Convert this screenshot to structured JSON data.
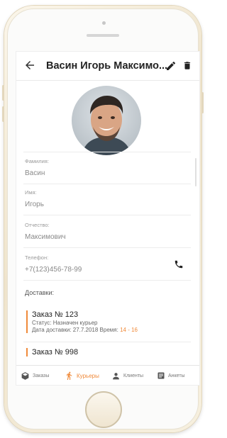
{
  "header": {
    "title": "Васин Игорь Максимо...",
    "back_icon": "arrow-left-icon",
    "edit_icon": "pencil-icon",
    "delete_icon": "trash-icon"
  },
  "fields": [
    {
      "label": "Фамилия:",
      "value": "Васин"
    },
    {
      "label": "Имя:",
      "value": "Игорь"
    },
    {
      "label": "Отчество:",
      "value": "Максимович"
    },
    {
      "label": "Телефон:",
      "value": "+7(123)456-78-99"
    }
  ],
  "deliveries": {
    "label": "Доставки:",
    "orders": [
      {
        "title": "Заказ № 123",
        "status": "Статус: Назначен курьер",
        "date": "Дата доставки: 27.7.2018 Время:",
        "time": "14 - 16"
      },
      {
        "title": "Заказ № 998",
        "status": "",
        "date": "",
        "time": ""
      }
    ]
  },
  "nav": {
    "items": [
      {
        "label": "Заказы",
        "icon": "box-icon"
      },
      {
        "label": "Курьеры",
        "icon": "walking-person-icon"
      },
      {
        "label": "Клиенты",
        "icon": "person-icon"
      },
      {
        "label": "Анкеты",
        "icon": "form-icon"
      }
    ],
    "active": "Курьеры"
  },
  "colors": {
    "accent": "#f08a3a",
    "text": "#222222",
    "muted": "#9a9a9a"
  }
}
